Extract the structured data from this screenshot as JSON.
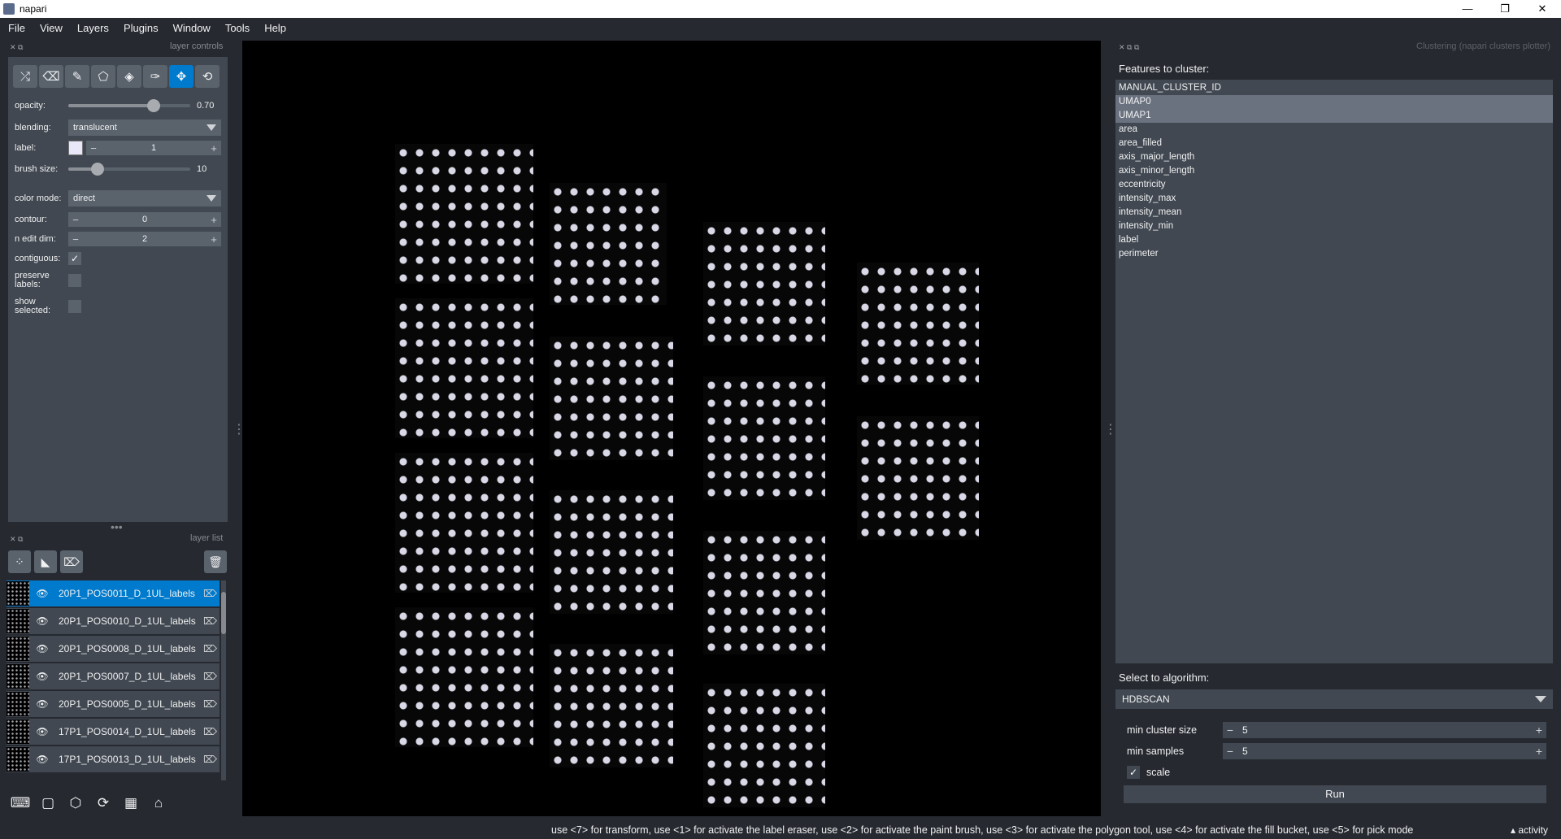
{
  "window": {
    "title": "napari",
    "minimize": "—",
    "maximize": "❐",
    "close": "✕"
  },
  "menu": [
    "File",
    "View",
    "Layers",
    "Plugins",
    "Window",
    "Tools",
    "Help"
  ],
  "layer_controls": {
    "title": "layer controls",
    "tools": [
      "shuffle-icon",
      "eraser-icon",
      "paintbrush-icon",
      "polygon-icon",
      "fill-bucket-icon",
      "picker-icon",
      "move-icon",
      "transform-icon"
    ],
    "active_tool": "move-icon",
    "opacity": {
      "label": "opacity:",
      "value": "0.70",
      "fraction": 0.7
    },
    "blending": {
      "label": "blending:",
      "value": "translucent"
    },
    "label": {
      "label": "label:",
      "value": "1"
    },
    "brush_size": {
      "label": "brush size:",
      "value": "10",
      "fraction": 0.24
    },
    "color_mode": {
      "label": "color mode:",
      "value": "direct"
    },
    "contour": {
      "label": "contour:",
      "value": "0"
    },
    "n_edit_dim": {
      "label": "n edit dim:",
      "value": "2"
    },
    "contiguous": {
      "label": "contiguous:",
      "checked": true
    },
    "preserve_labels": {
      "label": "preserve labels:",
      "checked": false
    },
    "show_selected": {
      "label": "show selected:",
      "checked": false
    }
  },
  "layer_list": {
    "title": "layer list",
    "layers": [
      {
        "name": "20P1_POS0011_D_1UL_labels",
        "selected": true
      },
      {
        "name": "20P1_POS0010_D_1UL_labels",
        "selected": false
      },
      {
        "name": "20P1_POS0008_D_1UL_labels",
        "selected": false
      },
      {
        "name": "20P1_POS0007_D_1UL_labels",
        "selected": false
      },
      {
        "name": "20P1_POS0005_D_1UL_labels",
        "selected": false
      },
      {
        "name": "17P1_POS0014_D_1UL_labels",
        "selected": false
      },
      {
        "name": "17P1_POS0013_D_1UL_labels",
        "selected": false
      }
    ]
  },
  "clustering": {
    "title": "Clustering (napari clusters plotter)",
    "features_label": "Features to cluster:",
    "features": [
      {
        "name": "MANUAL_CLUSTER_ID",
        "selected": false
      },
      {
        "name": "UMAP0",
        "selected": true
      },
      {
        "name": "UMAP1",
        "selected": true
      },
      {
        "name": "area",
        "selected": false
      },
      {
        "name": "area_filled",
        "selected": false
      },
      {
        "name": "axis_major_length",
        "selected": false
      },
      {
        "name": "axis_minor_length",
        "selected": false
      },
      {
        "name": "eccentricity",
        "selected": false
      },
      {
        "name": "intensity_max",
        "selected": false
      },
      {
        "name": "intensity_mean",
        "selected": false
      },
      {
        "name": "intensity_min",
        "selected": false
      },
      {
        "name": "label",
        "selected": false
      },
      {
        "name": "perimeter",
        "selected": false
      }
    ],
    "algorithm_label": "Select to algorithm:",
    "algorithm": "HDBSCAN",
    "min_cluster_size": {
      "label": "min cluster size",
      "value": "5"
    },
    "min_samples": {
      "label": "min samples",
      "value": "5"
    },
    "scale": {
      "label": "scale",
      "checked": true
    },
    "run_label": "Run"
  },
  "status": {
    "message": "use <7> for transform, use <1> for activate the label eraser, use <2> for activate the paint brush, use <3> for activate the polygon tool, use <4> for activate the fill bucket, use <5> for pick mode",
    "activity": "activity"
  }
}
